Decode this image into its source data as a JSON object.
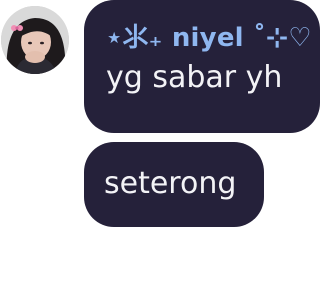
{
  "messages": [
    {
      "sender_name": "⋆⺢₊ niyel ˚⊹♡",
      "text": "yg sabar yh"
    },
    {
      "text": "seterong"
    }
  ],
  "colors": {
    "bubble": "#25213a",
    "sender_name": "#8fb7f0",
    "text": "#f3f3f6",
    "background": "#ffffff"
  }
}
